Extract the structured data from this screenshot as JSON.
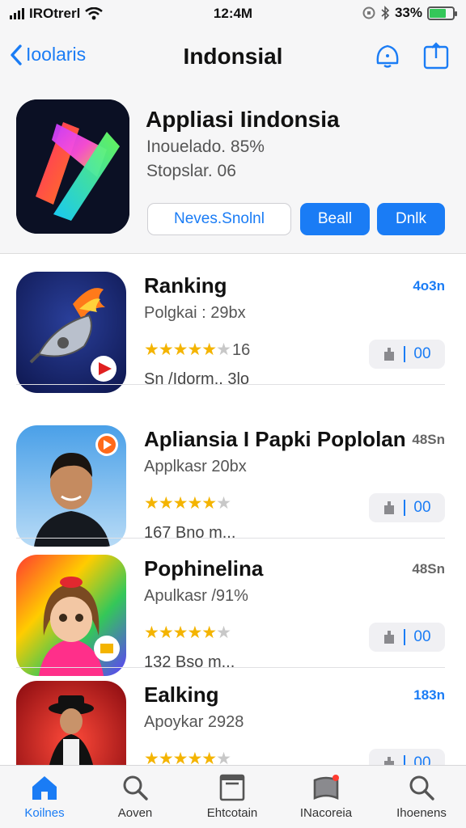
{
  "status_bar": {
    "carrier": "IROtrerl",
    "time": "12:4M",
    "battery": "33%"
  },
  "nav": {
    "back_label": "Ioolaris",
    "title": "Indonsial"
  },
  "hero": {
    "title": "Appliasi Iindonsia",
    "sub1": "Inouelado.   85%",
    "sub2": "Stopslar.  06",
    "btn_outline": "Neves.Snolnl",
    "btn_fill_1": "Beall",
    "btn_fill_2": "Dnlk"
  },
  "apps": [
    {
      "name": "Ranking",
      "sub": "Polgkai : 29bx",
      "rating": 5,
      "rating_count": "16",
      "meta": "Sn /Idorm.. 3lo",
      "size": "4o3n",
      "size_color": "#1a7cf5"
    },
    {
      "name": "Apliansia I Papki Poplolan",
      "sub": "Applkasr 20bx",
      "rating": 5,
      "rating_count": "",
      "meta": "167 Bno m...",
      "size": "48Sn",
      "size_color": "#666666"
    },
    {
      "name": "Pophinelina",
      "sub": "Apulkasr /91%",
      "rating": 5,
      "rating_count": "",
      "meta": "132 Bso m...",
      "size": "48Sn",
      "size_color": "#666666"
    },
    {
      "name": "Ealking",
      "sub": "Apoykar 2928",
      "rating": 5,
      "rating_count": "",
      "meta": "",
      "size": "183n",
      "size_color": "#1a7cf5"
    }
  ],
  "get_button_label": "00",
  "tabs": [
    {
      "label": "Koilnes",
      "icon": "home-icon",
      "active": true
    },
    {
      "label": "Aoven",
      "icon": "search-icon",
      "active": false
    },
    {
      "label": "Ehtcotain",
      "icon": "document-icon",
      "active": false
    },
    {
      "label": "INacoreia",
      "icon": "book-icon",
      "active": false
    },
    {
      "label": "Ihoenens",
      "icon": "search-icon",
      "active": false
    }
  ],
  "colors": {
    "accent": "#1a7cf5",
    "star": "#f4b400",
    "battery": "#34c759"
  }
}
